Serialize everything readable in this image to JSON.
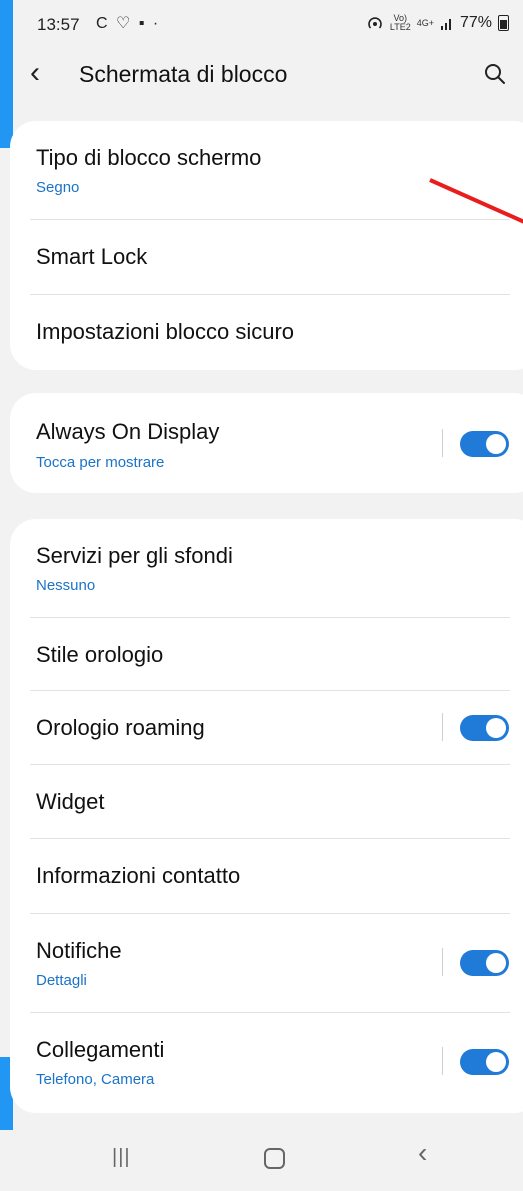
{
  "status": {
    "time": "13:57",
    "left_icons": "C ♡ ▪ ·",
    "net_top": "Vo)",
    "net_bottom": "LTE2",
    "net_type": "4G+",
    "battery": "77%"
  },
  "header": {
    "title": "Schermata di blocco"
  },
  "group1": [
    {
      "label": "Tipo di blocco schermo",
      "sub": "Segno"
    },
    {
      "label": "Smart Lock"
    },
    {
      "label": "Impostazioni blocco sicuro"
    }
  ],
  "group2": [
    {
      "label": "Always On Display",
      "sub": "Tocca per mostrare",
      "toggle": true
    }
  ],
  "group3": [
    {
      "label": "Servizi per gli sfondi",
      "sub": "Nessuno"
    },
    {
      "label": "Stile orologio"
    },
    {
      "label": "Orologio roaming",
      "toggle": true
    },
    {
      "label": "Widget"
    },
    {
      "label": "Informazioni contatto"
    },
    {
      "label": "Notifiche",
      "sub": "Dettagli",
      "toggle": true
    },
    {
      "label": "Collegamenti",
      "sub": "Telefono, Camera",
      "toggle": true
    }
  ],
  "nav": {
    "recent": "|||",
    "back": "‹"
  },
  "edge_char": "A",
  "colors": {
    "accent": "#1f7ad8",
    "link": "#1a73c8",
    "annotation": "#e81d1d"
  }
}
